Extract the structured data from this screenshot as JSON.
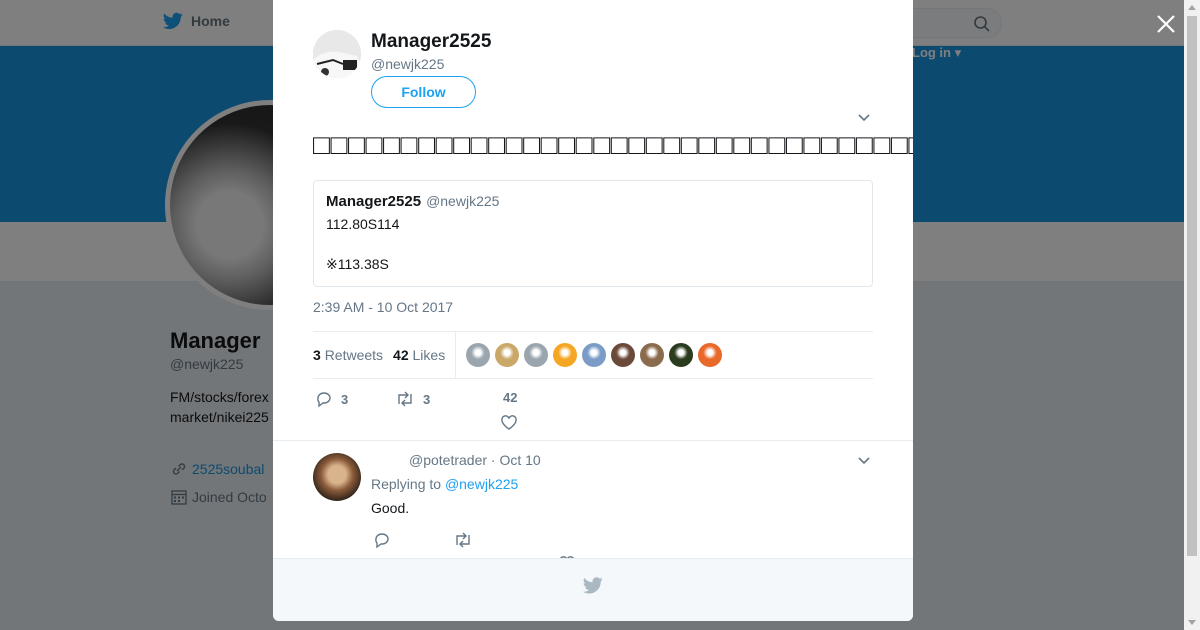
{
  "nav": {
    "home_label": "Home",
    "login_label": "Log in ▾"
  },
  "profile": {
    "name": "Manager",
    "handle": "@newjk225",
    "bio": "FM/stocks/forex market/nikei225 e",
    "link": "2525soubal",
    "joined": "Joined Octo"
  },
  "tweet": {
    "author_name": "Manager2525",
    "author_handle": "@newjk225",
    "follow_label": "Follow",
    "text": "□□□□□□□□□□□□□□□□□□□□□□□□□□□□□□□□□□□□",
    "quote": {
      "name": "Manager2525",
      "handle": "@newjk225",
      "line1": "112.80S114",
      "line2": "※113.38S"
    },
    "timestamp": "2:39 AM - 10 Oct 2017",
    "retweets_count": "3",
    "retweets_label": "Retweets",
    "likes_count": "42",
    "likes_label": "Likes",
    "reply_count": "3",
    "retweet_action_count": "3",
    "like_action_count": "42"
  },
  "reply": {
    "handle_date": "@potetrader · Oct 10",
    "replying_to_label": "Replying to",
    "replying_to_handle": "@newjk225",
    "text": "Good."
  },
  "colors": {
    "accent": "#1da1f2",
    "banner": "#1b95e0",
    "liker_colors": [
      "#9aa5ae",
      "#c9a86a",
      "#9aa5ae",
      "#f5a623",
      "#7a9cc6",
      "#6b4a3a",
      "#8b6b4e",
      "#2b3b1e",
      "#e8692a"
    ]
  }
}
